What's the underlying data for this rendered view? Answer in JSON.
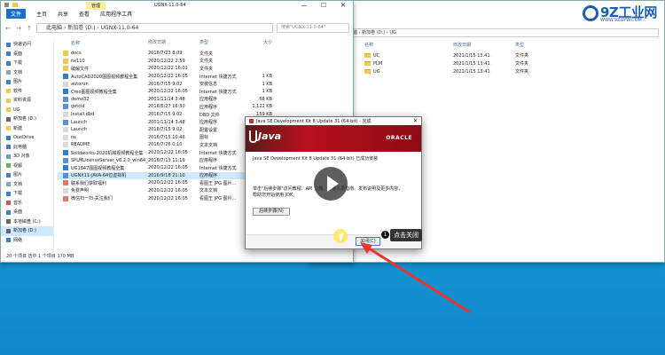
{
  "explorer_right": {
    "path": "此电脑 › 新加卷 (D:) › UG",
    "columns": [
      "名称",
      "修改日期",
      "类型"
    ],
    "rows": [
      {
        "name": "UC",
        "date": "2021/1/15 13:41",
        "type": "文件夹"
      },
      {
        "name": "PLM",
        "date": "2021/1/15 13:41",
        "type": "文件夹"
      },
      {
        "name": "UG",
        "date": "2021/1/15 13:41",
        "type": "文件夹"
      }
    ]
  },
  "watermark": {
    "big": "9Z工业网",
    "small": "WWW.9ZGYW.COM"
  },
  "explorer_main": {
    "ribbon": {
      "file": "文件",
      "home": "主页",
      "share": "共享",
      "view": "查看",
      "manage": "管理",
      "tools": "应用程序工具"
    },
    "window_title": "UGNX-11.0-64",
    "path": "此电脑 › 新加卷 (D:) › UGNX-11.0-64",
    "search_placeholder": "搜索\"UGNX-11.0-64\"",
    "columns": [
      "名称",
      "修改日期",
      "类型",
      "大小"
    ],
    "sidebar": [
      {
        "label": "快速访问",
        "icon": "star"
      },
      {
        "label": "桌面",
        "icon": "desktop"
      },
      {
        "label": "下载",
        "icon": "download"
      },
      {
        "label": "文档",
        "icon": "doc"
      },
      {
        "label": "图片",
        "icon": "picture"
      },
      {
        "label": "软件",
        "icon": "folder"
      },
      {
        "label": "资料资源",
        "icon": "folder"
      },
      {
        "label": "UG",
        "icon": "folder"
      },
      {
        "label": "新加卷 (D:)",
        "icon": "drive"
      },
      {
        "label": "新建",
        "icon": "folder"
      },
      {
        "label": "OneDrive",
        "icon": "cloud"
      },
      {
        "label": "此电脑",
        "icon": "pc"
      },
      {
        "label": "3D 对象",
        "icon": "3d"
      },
      {
        "label": "视频",
        "icon": "video"
      },
      {
        "label": "图片",
        "icon": "picture"
      },
      {
        "label": "文档",
        "icon": "doc"
      },
      {
        "label": "下载",
        "icon": "download"
      },
      {
        "label": "音乐",
        "icon": "music"
      },
      {
        "label": "桌面",
        "icon": "desktop"
      },
      {
        "label": "本地磁盘 (C:)",
        "icon": "drive"
      },
      {
        "label": "新加卷 (D:)",
        "icon": "drive"
      },
      {
        "label": "网络",
        "icon": "network"
      }
    ],
    "files": [
      {
        "name": "docs",
        "date": "2016/7/23 8:09",
        "type": "文件夹",
        "size": "",
        "icon": "folder"
      },
      {
        "name": "nx110",
        "date": "2020/12/22 2:59",
        "type": "文件夹",
        "size": "",
        "icon": "folder"
      },
      {
        "name": "破解文件",
        "date": "2020/12/22 16:01",
        "type": "文件夹",
        "size": "",
        "icon": "folder"
      },
      {
        "name": "AutoCAD2020图图视频教程全集",
        "date": "2020/12/22 16:05",
        "type": "Internet 快捷方式",
        "size": "1 KB",
        "icon": "link"
      },
      {
        "name": "autorun",
        "date": "2016/7/15 9:02",
        "type": "安装信息",
        "size": "1 KB",
        "icon": "file"
      },
      {
        "name": "Creo图图视频教程全集",
        "date": "2020/12/22 16:05",
        "type": "Internet 快捷方式",
        "size": "1 KB",
        "icon": "link"
      },
      {
        "name": "demo32",
        "date": "2001/11/14 3:48",
        "type": "应用程序",
        "size": "68 KB",
        "icon": "app"
      },
      {
        "name": "getcid",
        "date": "2016/6/27 16:30",
        "type": "应用程序",
        "size": "1,122 KB",
        "icon": "app"
      },
      {
        "name": "Install.dbd",
        "date": "2016/7/15 9:02",
        "type": "DBD 文件",
        "size": "159 KB",
        "icon": "file"
      },
      {
        "name": "Launch",
        "date": "2001/11/14 3:48",
        "type": "应用程序",
        "size": "68 KB",
        "icon": "app"
      },
      {
        "name": "Launch",
        "date": "2016/7/15 9:02",
        "type": "配置设置",
        "size": "2 KB",
        "icon": "file"
      },
      {
        "name": "nx",
        "date": "2016/7/15 10:46",
        "type": "图标",
        "size": "34 KB",
        "icon": "file"
      },
      {
        "name": "README",
        "date": "2016/7/26 0:10",
        "type": "文本文档",
        "size": "4 KB",
        "icon": "file"
      },
      {
        "name": "Solidworks-2020机械视频教程全集",
        "date": "2020/12/22 16:05",
        "type": "Internet 快捷方式",
        "size": "1 KB",
        "icon": "link"
      },
      {
        "name": "SPLMLicenseServer_v8.2.0_win64_setup",
        "date": "2016/7/13 11:19",
        "type": "应用程序",
        "size": "19,236 KB",
        "icon": "app"
      },
      {
        "name": "UG1847图图视频教程全集",
        "date": "2020/12/22 16:05",
        "type": "Internet 快捷方式",
        "size": "1 KB",
        "icon": "link"
      },
      {
        "name": "UGNX11-JAVA-64位虚拟机",
        "date": "2016/9/18 21:10",
        "type": "应用程序",
        "size": "156,617 KB",
        "icon": "app",
        "selected": true
      },
      {
        "name": "联系我们获取福利",
        "date": "2020/12/22 16:05",
        "type": "看图王 JPG 图片...",
        "size": "14 KB",
        "icon": "image"
      },
      {
        "name": "免费声明",
        "date": "2020/12/22 16:05",
        "type": "文本文档",
        "size": "1 KB",
        "icon": "file"
      },
      {
        "name": "微信扫一扫-关注我们",
        "date": "2020/12/22 16:05",
        "type": "看图王 JPG 图片...",
        "size": "61 KB",
        "icon": "image"
      }
    ],
    "status": "20 个项目    选中 1 个项目  170 MB"
  },
  "installer": {
    "title": "Java SE Development Kit 8 Update 31 (64-bit) - 完成",
    "brand": "Java",
    "vendor": "ORACLE",
    "message": "Java SE Development Kit 8 Update 31 (64-bit) 已成功安装",
    "note": "单击\"后续步骤\"访问教程、API 文档、开发人员指南、发布说明及更多内容，帮助您开始使用 JDK。",
    "next_steps": "后续步骤(N)",
    "close": "关闭(C)"
  },
  "annotation": {
    "number": "1",
    "label": "点击关闭"
  },
  "colors": {
    "desktop": "#1a8fd6",
    "java_red": "#b8111d",
    "selection": "#cde8ff",
    "arrow": "#e8352e"
  }
}
